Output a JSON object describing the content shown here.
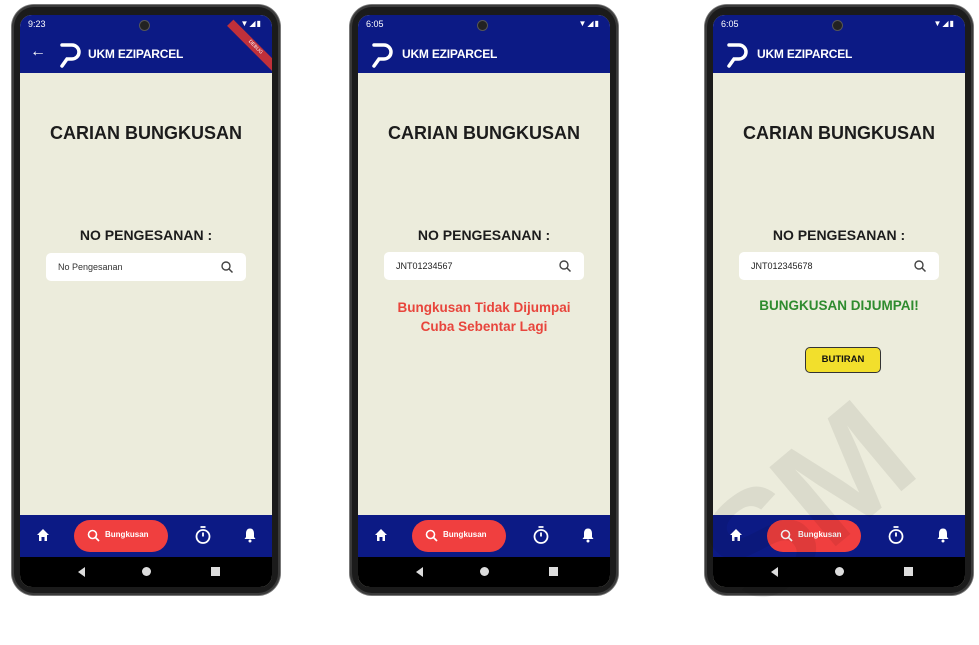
{
  "app": {
    "title": "UKM EZIPARCEL"
  },
  "colors": {
    "primary": "#0c1a85",
    "background": "#ececdc",
    "accent": "#f03f3f",
    "error": "#e8453c",
    "success": "#2e8b2e",
    "button": "#f2df2c"
  },
  "screens": [
    {
      "status_time": "9:23",
      "heading": "CARIAN BUNGKUSAN",
      "label": "NO PENGESANAN :",
      "search": {
        "value": "",
        "placeholder": "No Pengesanan"
      },
      "debug_banner": "DEBUG"
    },
    {
      "status_time": "6:05",
      "heading": "CARIAN BUNGKUSAN",
      "label": "NO PENGESANAN :",
      "search": {
        "value": "JNT01234567",
        "placeholder": "No Pengesanan"
      },
      "result_line1": "Bungkusan Tidak Dijumpai",
      "result_line2": "Cuba Sebentar Lagi"
    },
    {
      "status_time": "6:05",
      "heading": "CARIAN BUNGKUSAN",
      "label": "NO PENGESANAN :",
      "search": {
        "value": "JNT012345678",
        "placeholder": "No Pengesanan"
      },
      "result": "BUNGKUSAN DIJUMPAI!",
      "detail_button": "BUTIRAN"
    }
  ],
  "nav": {
    "search_label": "Bungkusan"
  },
  "icons": [
    "back-arrow-icon",
    "logo-icon",
    "search-icon",
    "home-icon",
    "timer-icon",
    "bell-icon"
  ],
  "watermark": "SM"
}
